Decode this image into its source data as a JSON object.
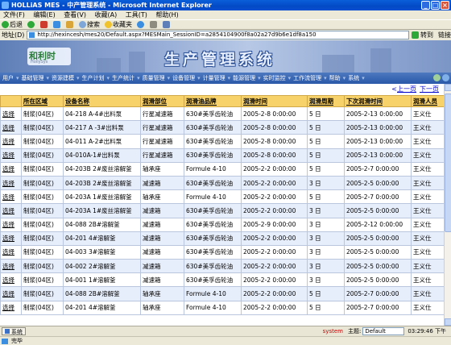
{
  "window": {
    "title": "HOLLiAS  MES  - 中产管理系统 - Microsoft Internet Explorer",
    "controls": [
      "_",
      "□",
      "×"
    ]
  },
  "menubar": [
    "文件(F)",
    "编辑(E)",
    "查看(V)",
    "收藏(A)",
    "工具(T)",
    "帮助(H)"
  ],
  "toolbar": {
    "back": "后退",
    "search": "搜索",
    "favorites": "收藏夹"
  },
  "address": {
    "label": "地址(D)",
    "url": "http://hexincesh/mes20/Default.aspx?MESMain_SessionID=a2854104900f8a02a27d9b6e1df8a150",
    "go": "转到",
    "links": "链接"
  },
  "banner": {
    "logo": "和利时",
    "logo_sub": "HollySys",
    "title": "生产管理系统"
  },
  "nav": {
    "items": [
      "用户",
      "基础管理",
      "资源建模",
      "生产计划",
      "生产统计",
      "质量管理",
      "设备管理",
      "计量管理",
      "能源管理",
      "实时监控",
      "工作流管理",
      "帮助",
      "系统"
    ]
  },
  "pager": {
    "prev": "上一页",
    "next": "下一页"
  },
  "table": {
    "select_label": "选择",
    "headers": [
      "所在区域",
      "设备名称",
      "润滑部位",
      "润滑油品牌",
      "润滑时间",
      "润滑周期",
      "下次润滑时间",
      "润滑人员"
    ],
    "rows": [
      [
        "制浆(04区)",
        "04-218 A-4#出料泵",
        "行星减速箱",
        "630#美孚齿轮油",
        "2005-2-8 0:00:00",
        "5 日",
        "2005-2-13 0:00:00",
        "王义仕"
      ],
      [
        "制浆(04区)",
        "04-217 A -3#出料泵",
        "行星减速箱",
        "630#美孚齿轮油",
        "2005-2-8 0:00:00",
        "5 日",
        "2005-2-13 0:00:00",
        "王义仕"
      ],
      [
        "制浆(04区)",
        "04-011 A-2#出料泵",
        "行星减速箱",
        "630#美孚齿轮油",
        "2005-2-8 0:00:00",
        "5 日",
        "2005-2-13 0:00:00",
        "王义仕"
      ],
      [
        "制浆(04区)",
        "04-010A-1#出料泵",
        "行星减速箱",
        "630#美孚齿轮油",
        "2005-2-8 0:00:00",
        "5 日",
        "2005-2-13 0:00:00",
        "王义仕"
      ],
      [
        "制浆(04区)",
        "04-203B 2#废丝溶解釜",
        "轴承座",
        "Formule 4-10",
        "2005-2-2 0:00:00",
        "5 日",
        "2005-2-7 0:00:00",
        "王义仕"
      ],
      [
        "制浆(04区)",
        "04-203B 2#废丝溶解釜",
        "减速箱",
        "630#美孚齿轮油",
        "2005-2-2 0:00:00",
        "3 日",
        "2005-2-5 0:00:00",
        "王义仕"
      ],
      [
        "制浆(04区)",
        "04-203A 1#废丝溶解釜",
        "轴承座",
        "Formule 4-10",
        "2005-2-2 0:00:00",
        "5 日",
        "2005-2-7 0:00:00",
        "王义仕"
      ],
      [
        "制浆(04区)",
        "04-203A 1#废丝溶解釜",
        "减速箱",
        "630#美孚齿轮油",
        "2005-2-2 0:00:00",
        "3 日",
        "2005-2-5 0:00:00",
        "王义仕"
      ],
      [
        "制浆(04区)",
        "04-088 2B#溶解釜",
        "减速箱",
        "630#美孚齿轮油",
        "2005-2-9 0:00:00",
        "3 日",
        "2005-2-12 0:00:00",
        "王义仕"
      ],
      [
        "制浆(04区)",
        "04-201 4#溶解釜",
        "减速箱",
        "630#美孚齿轮油",
        "2005-2-2 0:00:00",
        "3 日",
        "2005-2-5 0:00:00",
        "王义仕"
      ],
      [
        "制浆(04区)",
        "04-003 3#溶解釜",
        "减速箱",
        "630#美孚齿轮油",
        "2005-2-2 0:00:00",
        "3 日",
        "2005-2-5 0:00:00",
        "王义仕"
      ],
      [
        "制浆(04区)",
        "04-002 2#溶解釜",
        "减速箱",
        "630#美孚齿轮油",
        "2005-2-2 0:00:00",
        "3 日",
        "2005-2-5 0:00:00",
        "王义仕"
      ],
      [
        "制浆(04区)",
        "04-001 1#溶解釜",
        "减速箱",
        "630#美孚齿轮油",
        "2005-2-2 0:00:00",
        "3 日",
        "2005-2-5 0:00:00",
        "王义仕"
      ],
      [
        "制浆(04区)",
        "04-088 2B#溶解釜",
        "轴承座",
        "Formule 4-10",
        "2005-2-2 0:00:00",
        "5 日",
        "2005-2-7 0:00:00",
        "王义仕"
      ],
      [
        "制浆(04区)",
        "04-201 4#溶解釜",
        "轴承座",
        "Formule 4-10",
        "2005-2-2 0:00:00",
        "5 日",
        "2005-2-7 0:00:00",
        "王义仕"
      ]
    ]
  },
  "taskbar": {
    "system_button": "系统",
    "user": "system",
    "theme_label": "主题:",
    "theme_value": "Default",
    "time": "03:29:46 下午"
  },
  "status": {
    "text": "完毕"
  },
  "colors": {
    "header_bg": "#f7d16a",
    "row_alt": "#e7eefb",
    "nav_bg": "#2a58a8"
  }
}
